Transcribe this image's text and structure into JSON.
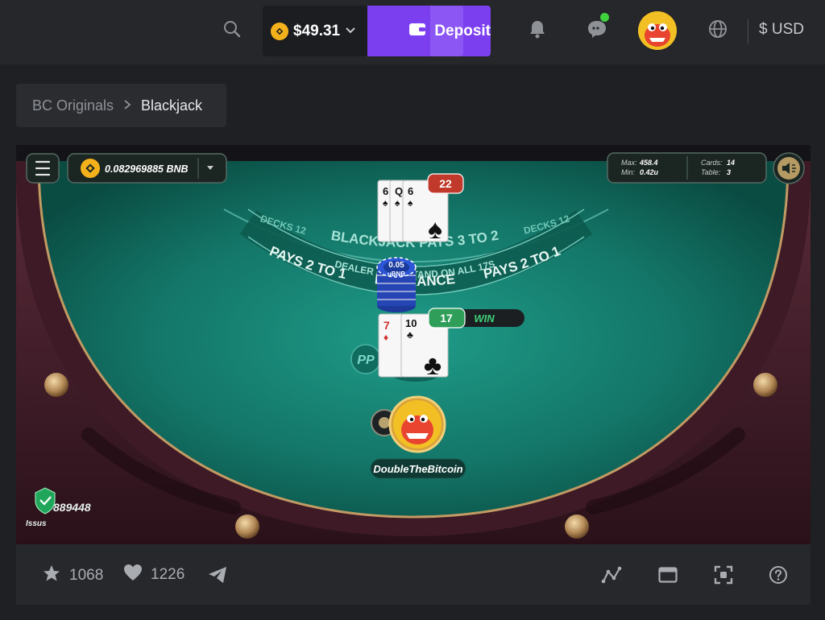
{
  "header": {
    "balance": "$49.31",
    "deposit_label": "Deposit",
    "currency": "$ USD",
    "colors": {
      "deposit": "#7b3ff0",
      "online": "#3fd33d",
      "coin": "#f3b21b"
    }
  },
  "breadcrumb": {
    "parent": "BC Originals",
    "current": "Blackjack"
  },
  "game": {
    "bet_balance": "0.082969885 BNB",
    "limits": {
      "max_label": "Max:",
      "max": "458.4",
      "min_label": "Min:",
      "min": "0.42u"
    },
    "shoe": {
      "cards_label": "Cards:",
      "cards": "14",
      "table_label": "Table:",
      "table": "3"
    },
    "table_text": {
      "decks_left": "DECKS 12",
      "decks_right": "DECKS 12",
      "blackjack_pays": "BLACKJACK PAYS 3 TO 2",
      "dealer_rule": "DEALER MUST STAND ON ALL 17S",
      "pays_left": "PAYS 2 TO 1",
      "insurance": "INSURANCE",
      "pays_right": "PAYS 2 TO 1"
    },
    "dealer": {
      "total": "22",
      "cards": [
        {
          "rank": "6",
          "suit": "♠"
        },
        {
          "rank": "Q",
          "suit": "♠"
        },
        {
          "rank": "6",
          "suit": "♠"
        }
      ]
    },
    "chip": {
      "amount": "0.05",
      "unit": "uBNB"
    },
    "player": {
      "total": "17",
      "result": "WIN",
      "name": "DoubleTheBitcoin",
      "cards": [
        {
          "rank": "7",
          "suit": "♦"
        },
        {
          "rank": "10",
          "suit": "♣"
        }
      ]
    },
    "logo_text": "PP",
    "verified": {
      "id": "889448",
      "label": "Issus"
    }
  },
  "footer": {
    "favorites": "1068",
    "likes": "1226"
  },
  "icons": {
    "header": [
      "search-icon",
      "chevron-down-icon",
      "wallet-icon",
      "bell-icon",
      "chat-icon",
      "globe-icon"
    ],
    "game": [
      "menu-icon",
      "bnb-coin-icon",
      "dropdown-icon",
      "sound-icon",
      "shield-icon"
    ],
    "footer": [
      "star-icon",
      "heart-icon",
      "telegram-icon",
      "stats-icon",
      "window-icon",
      "fullscreen-icon",
      "help-icon"
    ]
  }
}
